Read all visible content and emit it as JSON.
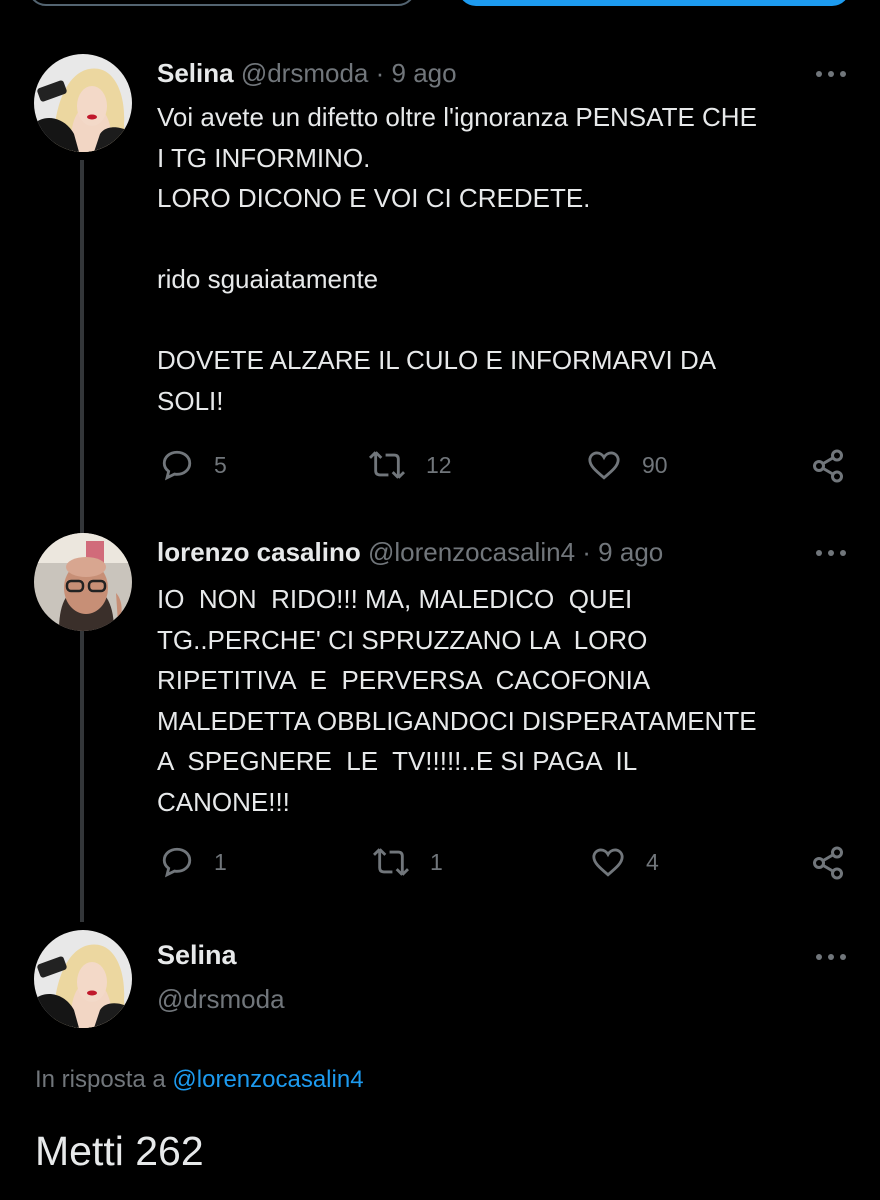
{
  "colors": {
    "background": "#000000",
    "text": "#e7e9ea",
    "secondary": "#71767b",
    "accent": "#1d9bf0"
  },
  "tweets": [
    {
      "name": "Selina",
      "handle": "@drsmoda",
      "separator": "·",
      "time": "9 ago",
      "text": "Voi avete un difetto oltre l'ignoranza PENSATE CHE\nI TG INFORMINO.\nLORO DICONO E VOI CI CREDETE.\n\nrido sguaiatamente\n\nDOVETE ALZARE IL CULO E INFORMARVI DA\nSOLI!",
      "replies": "5",
      "retweets": "12",
      "likes": "90"
    },
    {
      "name": "lorenzo casalino",
      "handle": "@lorenzocasalin4",
      "separator": "·",
      "time": "9 ago",
      "text": "IO  NON  RIDO!!! MA, MALEDICO  QUEI\nTG..PERCHE' CI SPRUZZANO LA  LORO\nRIPETITIVA  E  PERVERSA  CACOFONIA\nMALEDETTA OBBLIGANDOCI DISPERATAMENTE\nA  SPEGNERE  LE  TV!!!!!..E SI PAGA  IL\nCANONE!!!",
      "replies": "1",
      "retweets": "1",
      "likes": "4"
    }
  ],
  "focused": {
    "name": "Selina",
    "handle": "@drsmoda",
    "reply_prefix": "In risposta a",
    "reply_mention": "@lorenzocasalin4",
    "text": "Metti 262"
  },
  "icons": {
    "reply": "reply-icon",
    "retweet": "retweet-icon",
    "like": "heart-icon",
    "share": "share-icon",
    "more": "more-icon"
  }
}
